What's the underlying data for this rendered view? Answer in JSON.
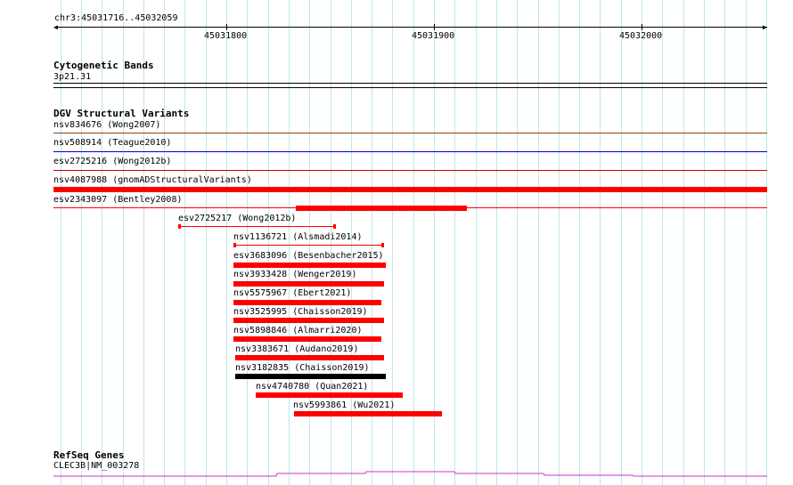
{
  "ruler": {
    "range_label": "chr3:45031716..45032059",
    "ticks": [
      "45031800",
      "45031900",
      "45032000"
    ]
  },
  "tracks": {
    "cytobands": {
      "title": "Cytogenetic Bands",
      "band": "3p21.31"
    },
    "dgv": {
      "title": "DGV Structural Variants",
      "variants": [
        {
          "label": "nsv834676 (Wong2007)",
          "color": "#8b4513"
        },
        {
          "label": "nsv508914 (Teague2010)",
          "color": "#0000cc"
        },
        {
          "label": "esv2725216 (Wong2012b)",
          "color": "#cc0000"
        },
        {
          "label": "nsv4087988 (gnomADStructuralVariants)",
          "color": "#ff0000"
        },
        {
          "label": "esv2343097 (Bentley2008)",
          "color": "#ff0000"
        },
        {
          "label": "esv2725217 (Wong2012b)",
          "color": "#ff0000"
        },
        {
          "label": "nsv1136721 (Alsmadi2014)",
          "color": "#ff0000"
        },
        {
          "label": "esv3683096 (Besenbacher2015)",
          "color": "#ff0000"
        },
        {
          "label": "nsv3933428 (Wenger2019)",
          "color": "#ff0000"
        },
        {
          "label": "nsv5575967 (Ebert2021)",
          "color": "#ff0000"
        },
        {
          "label": "nsv3525995 (Chaisson2019)",
          "color": "#ff0000"
        },
        {
          "label": "nsv5898846 (Almarri2020)",
          "color": "#ff0000"
        },
        {
          "label": "nsv3383671 (Audano2019)",
          "color": "#ff0000"
        },
        {
          "label": "nsv3182835 (Chaisson2019)",
          "color": "#000000"
        },
        {
          "label": "nsv4740780 (Quan2021)",
          "color": "#ff0000"
        },
        {
          "label": "nsv5993861 (Wu2021)",
          "color": "#ff0000"
        }
      ]
    },
    "refseq": {
      "title": "RefSeq Genes",
      "gene": "CLEC3B|NM_003278",
      "color": "#cc33cc"
    }
  }
}
